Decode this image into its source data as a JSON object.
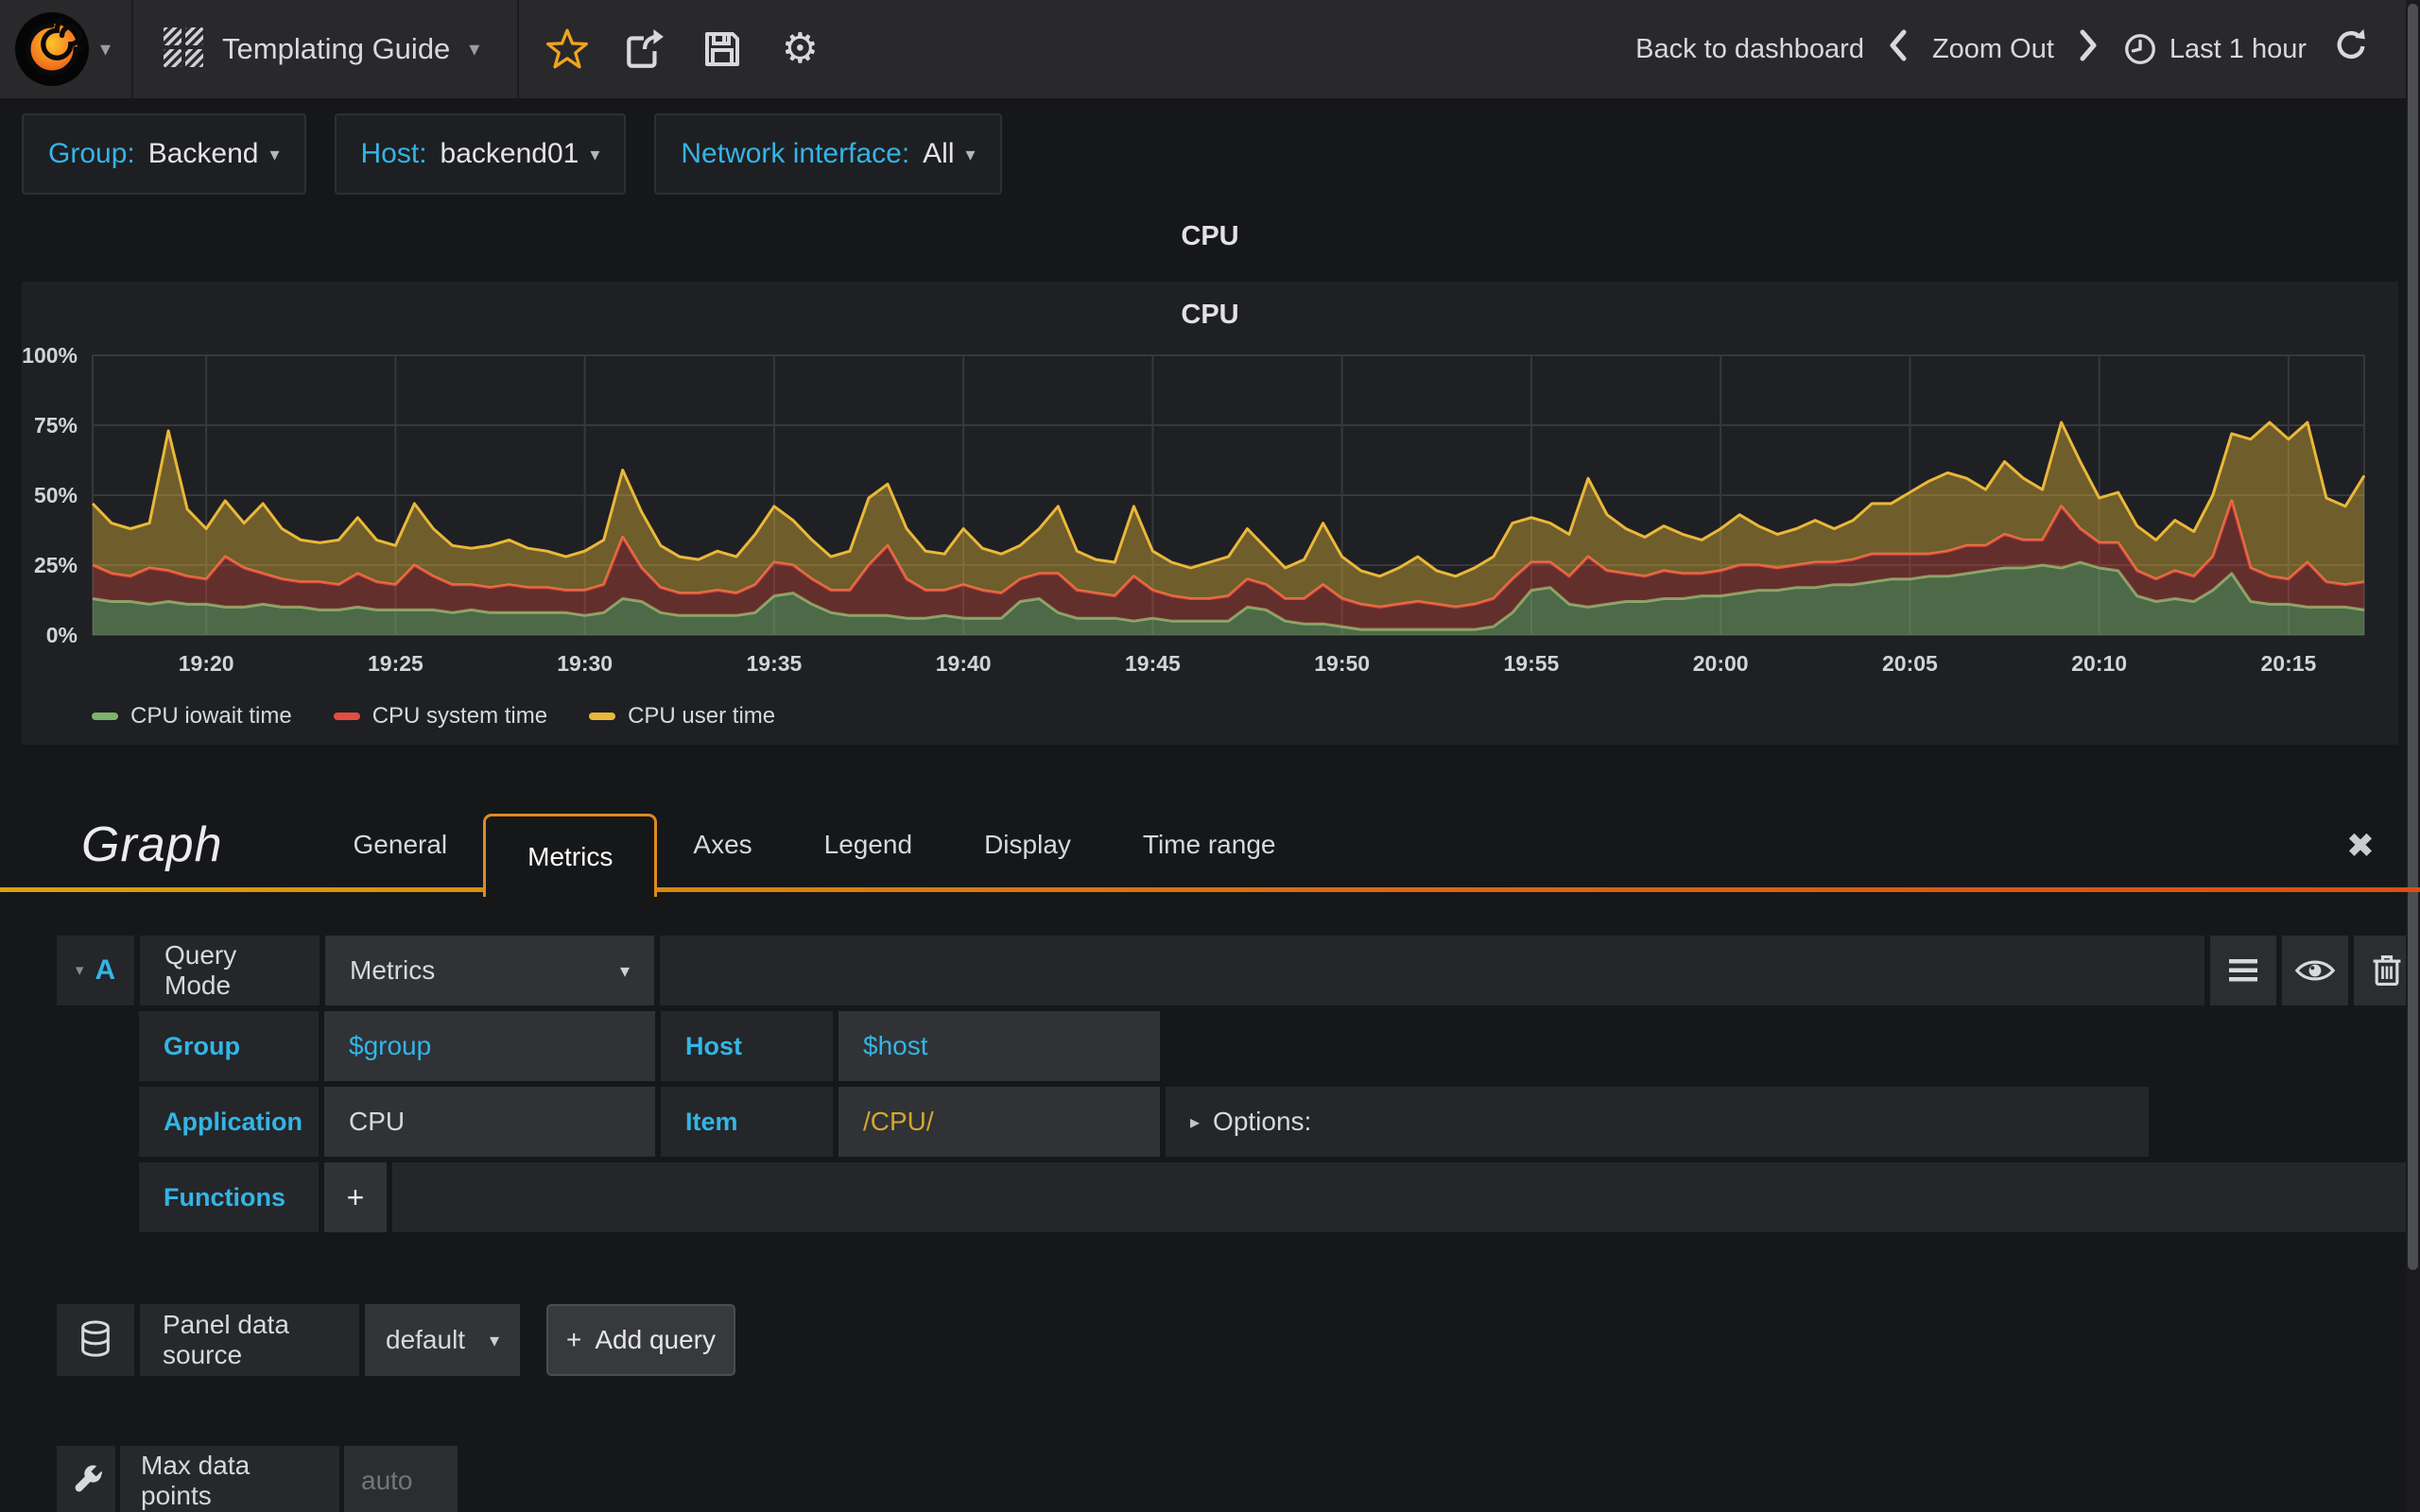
{
  "icons": {
    "caret_down": "▾",
    "caret_right": "▸",
    "close": "✖",
    "gear": "⚙",
    "plus": "+"
  },
  "navbar": {
    "dashboard_title": "Templating Guide",
    "back_label": "Back to dashboard",
    "zoom_out_label": "Zoom Out",
    "time_label": "Last 1 hour"
  },
  "variables": [
    {
      "label": "Group:",
      "value": "Backend"
    },
    {
      "label": "Host:",
      "value": "backend01"
    },
    {
      "label": "Network interface:",
      "value": "All"
    }
  ],
  "panel": {
    "title": "CPU"
  },
  "chart_data": {
    "type": "area",
    "stacked": true,
    "title": "CPU",
    "xlabel": "",
    "ylabel": "",
    "ylim": [
      0,
      100
    ],
    "ytick_labels": [
      "0%",
      "25%",
      "50%",
      "75%",
      "100%"
    ],
    "grid": true,
    "legend_position": "bottom-left",
    "x_start": "19:17",
    "x_end": "20:17",
    "x_step_seconds": 30,
    "x_tick_labels": [
      "19:20",
      "19:25",
      "19:30",
      "19:35",
      "19:40",
      "19:45",
      "19:50",
      "19:55",
      "20:00",
      "20:05",
      "20:10",
      "20:15"
    ],
    "x_tick_indices": [
      6,
      16,
      26,
      36,
      46,
      56,
      66,
      76,
      86,
      96,
      106,
      116
    ],
    "series": [
      {
        "name": "CPU iowait time",
        "color": "#7EB26D",
        "fill_opacity": 0.5,
        "values": [
          13,
          12,
          12,
          11,
          12,
          11,
          11,
          10,
          10,
          11,
          10,
          10,
          9,
          9,
          10,
          9,
          9,
          9,
          9,
          8,
          9,
          8,
          8,
          8,
          8,
          8,
          7,
          8,
          13,
          12,
          8,
          7,
          7,
          7,
          7,
          8,
          14,
          15,
          11,
          8,
          7,
          7,
          7,
          6,
          6,
          7,
          6,
          6,
          6,
          12,
          13,
          8,
          6,
          6,
          6,
          5,
          6,
          5,
          5,
          5,
          5,
          10,
          9,
          5,
          4,
          4,
          3,
          2,
          2,
          2,
          2,
          2,
          2,
          2,
          3,
          8,
          16,
          17,
          11,
          10,
          11,
          12,
          12,
          13,
          13,
          14,
          14,
          15,
          16,
          16,
          17,
          17,
          18,
          18,
          19,
          20,
          20,
          21,
          21,
          22,
          23,
          24,
          24,
          25,
          24,
          26,
          24,
          23,
          14,
          12,
          13,
          12,
          16,
          22,
          12,
          11,
          11,
          10,
          10,
          10,
          9
        ]
      },
      {
        "name": "CPU system time",
        "color": "#E24D42",
        "fill_opacity": 0.35,
        "values": [
          12,
          10,
          9,
          13,
          11,
          10,
          9,
          18,
          14,
          11,
          10,
          9,
          10,
          9,
          12,
          10,
          9,
          16,
          12,
          10,
          9,
          9,
          10,
          9,
          9,
          8,
          9,
          10,
          22,
          12,
          9,
          8,
          8,
          9,
          8,
          10,
          12,
          10,
          9,
          8,
          9,
          18,
          25,
          14,
          10,
          9,
          12,
          10,
          9,
          8,
          9,
          14,
          10,
          9,
          8,
          16,
          10,
          9,
          8,
          8,
          9,
          10,
          9,
          8,
          9,
          14,
          10,
          9,
          8,
          9,
          10,
          9,
          8,
          9,
          10,
          12,
          10,
          9,
          10,
          18,
          12,
          10,
          9,
          10,
          9,
          8,
          9,
          10,
          9,
          8,
          8,
          9,
          8,
          9,
          10,
          9,
          9,
          8,
          9,
          10,
          9,
          12,
          10,
          9,
          22,
          12,
          9,
          10,
          9,
          8,
          10,
          9,
          12,
          26,
          12,
          10,
          9,
          16,
          9,
          8,
          10
        ]
      },
      {
        "name": "CPU user time",
        "color": "#EAB839",
        "fill_opacity": 0.4,
        "values": [
          22,
          18,
          17,
          16,
          50,
          24,
          18,
          20,
          16,
          25,
          18,
          15,
          14,
          16,
          20,
          15,
          14,
          22,
          17,
          14,
          13,
          15,
          16,
          14,
          13,
          12,
          14,
          16,
          24,
          20,
          15,
          13,
          12,
          14,
          13,
          18,
          20,
          16,
          14,
          12,
          14,
          24,
          22,
          18,
          14,
          13,
          20,
          15,
          14,
          12,
          16,
          24,
          14,
          12,
          12,
          25,
          14,
          12,
          11,
          13,
          14,
          18,
          13,
          11,
          14,
          22,
          15,
          12,
          11,
          13,
          16,
          12,
          11,
          13,
          15,
          20,
          16,
          14,
          15,
          28,
          20,
          16,
          14,
          16,
          14,
          12,
          15,
          18,
          14,
          12,
          13,
          15,
          12,
          14,
          18,
          18,
          22,
          26,
          28,
          24,
          20,
          26,
          22,
          18,
          30,
          24,
          16,
          18,
          16,
          14,
          18,
          16,
          22,
          24,
          46,
          55,
          50,
          50,
          30,
          28,
          38
        ]
      }
    ]
  },
  "editor": {
    "title": "Graph",
    "tabs": [
      "General",
      "Metrics",
      "Axes",
      "Legend",
      "Display",
      "Time range"
    ],
    "active_tab": "Metrics",
    "query": {
      "letter": "A",
      "query_mode_label": "Query Mode",
      "query_mode_value": "Metrics",
      "group_label": "Group",
      "group_value": "$group",
      "host_label": "Host",
      "host_value": "$host",
      "application_label": "Application",
      "application_value": "CPU",
      "item_label": "Item",
      "item_value": "/CPU/",
      "options_label": "Options:",
      "functions_label": "Functions"
    },
    "datasource": {
      "label": "Panel data source",
      "value": "default",
      "add_query_label": "Add query"
    },
    "max_data_points": {
      "label": "Max data points",
      "placeholder": "auto"
    }
  },
  "colors": {
    "accent_blue": "#33b5e5",
    "tab_orange": "#dd8a22",
    "underline_gradient": [
      "#d9a10d",
      "#dd4e12"
    ],
    "star_orange": "#f0a51c",
    "panel_bg": "#1f2023",
    "navbar_bg": "#29292b"
  }
}
